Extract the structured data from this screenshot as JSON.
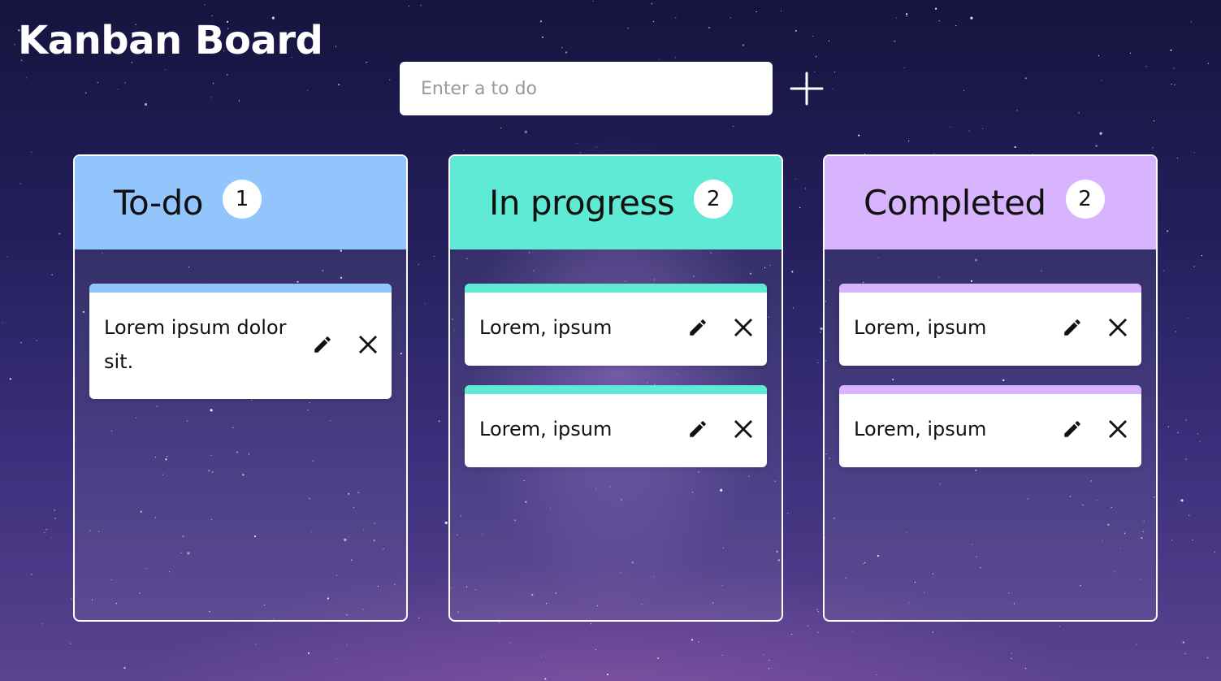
{
  "header": {
    "title": "Kanban Board",
    "input_placeholder": "Enter a to do",
    "add_icon": "plus-icon"
  },
  "colors": {
    "todo": "#93c5fd",
    "in_progress": "#5eead4",
    "completed": "#d8b4fe"
  },
  "columns": [
    {
      "title": "To-do",
      "count": "1",
      "cards": [
        {
          "text": "Lorem ipsum dolor sit.",
          "edit_icon": "pencil-icon",
          "delete_icon": "close-icon"
        }
      ]
    },
    {
      "title": "In progress",
      "count": "2",
      "cards": [
        {
          "text": "Lorem, ipsum",
          "edit_icon": "pencil-icon",
          "delete_icon": "close-icon"
        },
        {
          "text": "Lorem, ipsum",
          "edit_icon": "pencil-icon",
          "delete_icon": "close-icon"
        }
      ]
    },
    {
      "title": "Completed",
      "count": "2",
      "cards": [
        {
          "text": "Lorem, ipsum",
          "edit_icon": "pencil-icon",
          "delete_icon": "close-icon"
        },
        {
          "text": "Lorem, ipsum",
          "edit_icon": "pencil-icon",
          "delete_icon": "close-icon"
        }
      ]
    }
  ]
}
